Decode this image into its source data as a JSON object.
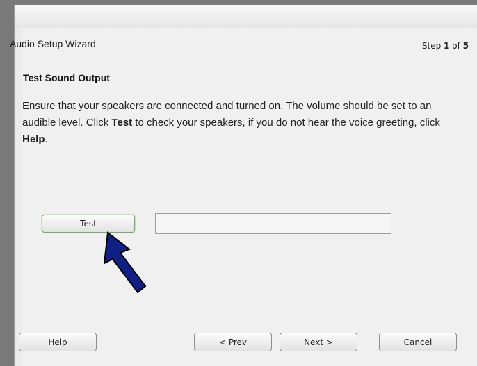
{
  "wizard": {
    "title": "Audio Setup Wizard",
    "step_label": "Step",
    "step_current": "1",
    "step_of": "of",
    "step_total": "5"
  },
  "section": {
    "title": "Test Sound Output",
    "text_1": "Ensure that your speakers are connected and turned on. The volume should be set to an audible level. Click ",
    "text_bold_1": "Test",
    "text_2": " to check your speakers, if you do not hear the voice greeting, click ",
    "text_bold_2": "Help",
    "text_3": "."
  },
  "test": {
    "button_label": "Test",
    "result_value": ""
  },
  "footer": {
    "help_label": "Help",
    "prev_label": "< Prev",
    "next_label": "Next >",
    "cancel_label": "Cancel"
  },
  "colors": {
    "arrow": "#0e1f86"
  }
}
